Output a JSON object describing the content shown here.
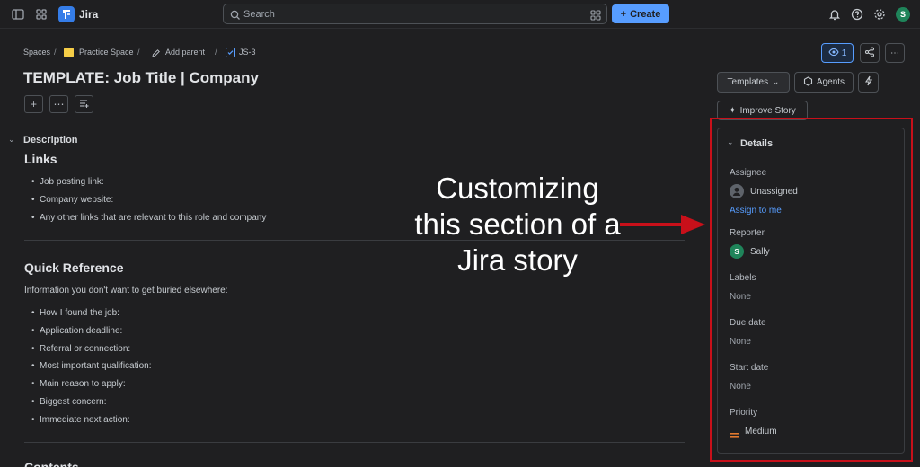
{
  "topbar": {
    "app_name": "Jira",
    "search_placeholder": "Search",
    "create_label": "Create",
    "avatar_initial": "S"
  },
  "breadcrumb": {
    "spaces": "Spaces",
    "project": "Practice Space",
    "add_parent": "Add parent",
    "issue_key": "JS-3",
    "separator": "/"
  },
  "issue": {
    "title": "TEMPLATE: Job Title | Company",
    "watch_count": "1"
  },
  "description": {
    "heading": "Description",
    "links_heading": "Links",
    "links_items": [
      "Job posting link:",
      "Company website:",
      "Any other links that are relevant to this role and company"
    ],
    "quick_ref_heading": "Quick Reference",
    "quick_ref_intro": "Information you don't want to get buried elsewhere:",
    "quick_ref_items": [
      "How I found the job:",
      "Application deadline:",
      "Referral or connection:",
      "Most important qualification:",
      "Main reason to apply:",
      "Biggest concern:",
      "Immediate next action:"
    ],
    "contents_heading": "Contents"
  },
  "sidebar": {
    "templates_label": "Templates",
    "agents_label": "Agents",
    "improve_label": "Improve Story",
    "details_heading": "Details",
    "assignee_label": "Assignee",
    "assignee_value": "Unassigned",
    "assign_to_me": "Assign to me",
    "reporter_label": "Reporter",
    "reporter_value": "Sally",
    "reporter_initial": "S",
    "labels_label": "Labels",
    "labels_value": "None",
    "due_date_label": "Due date",
    "due_date_value": "None",
    "start_date_label": "Start date",
    "start_date_value": "None",
    "priority_label": "Priority",
    "priority_value": "Medium"
  },
  "annotation": {
    "line1": "Customizing",
    "line2": "this section of a",
    "line3": "Jira story"
  },
  "colors": {
    "accent": "#579dff",
    "annotation_red": "#c8101a",
    "priority": "#e2792e"
  }
}
